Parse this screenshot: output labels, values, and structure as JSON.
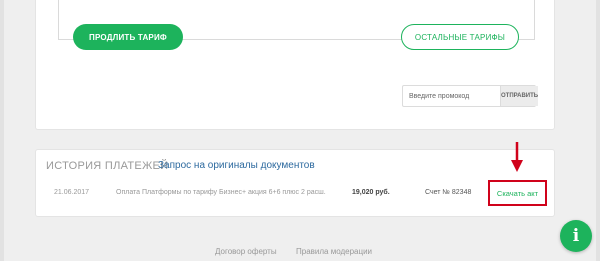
{
  "tariff": {
    "extend_button": "ПРОДЛИТЬ ТАРИФ",
    "other_tariffs_button": "ОСТАЛЬНЫЕ ТАРИФЫ"
  },
  "promo": {
    "placeholder": "Введите промокод",
    "submit_label": "ОТПРАВИТЬ"
  },
  "history": {
    "title": "ИСТОРИЯ ПЛАТЕЖЕЙ",
    "request_originals_link": "Запрос на оригиналы документов",
    "rows": [
      {
        "date": "21.06.2017",
        "description": "Оплата Платформы по тарифу Бизнес+ акция 6+6 плюс 2 расш.",
        "amount": "19,020 руб.",
        "invoice": "Счет № 82348",
        "download_label": "Скачать акт"
      }
    ]
  },
  "footer": {
    "offer_link": "Договор оферты",
    "moderation_link": "Правила модерации"
  },
  "colors": {
    "accent": "#1db35c",
    "highlight": "#d0021b",
    "link": "#2d6a9f"
  },
  "icons": {
    "fab": "info-icon",
    "annotation": "arrow-down-icon"
  }
}
